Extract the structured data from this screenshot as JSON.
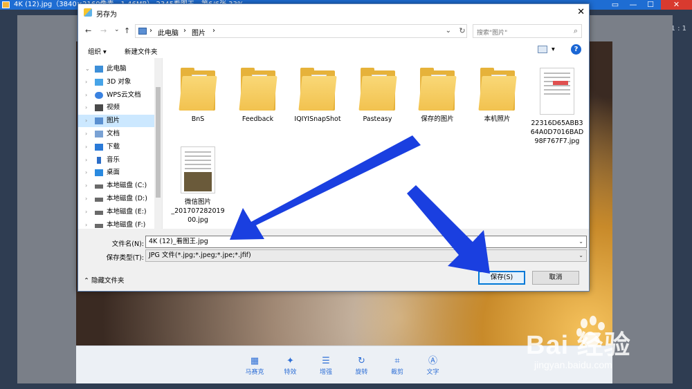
{
  "viewer": {
    "title": "4K (12).jpg（3840×2160像素，1.46MB）  2345看图王 - 第6/6张 33%",
    "zoom_label": "1 : 1",
    "window_controls": [
      "▭",
      "—",
      "☐",
      "✕"
    ],
    "toolbar": [
      {
        "label": "马赛克",
        "icon": "mosaic-icon",
        "glyph": "▦"
      },
      {
        "label": "特效",
        "icon": "magic-wand-icon",
        "glyph": "✦"
      },
      {
        "label": "增强",
        "icon": "sliders-icon",
        "glyph": "☰"
      },
      {
        "label": "旋转",
        "icon": "rotate-icon",
        "glyph": "↻"
      },
      {
        "label": "裁剪",
        "icon": "crop-icon",
        "glyph": "⌗"
      },
      {
        "label": "文字",
        "icon": "text-icon",
        "glyph": "Ⓐ"
      }
    ]
  },
  "dialog": {
    "title": "另存为",
    "close_glyph": "✕",
    "nav": {
      "back": "←",
      "forward": "→",
      "recent": "⌄",
      "up": "↑"
    },
    "breadcrumb": [
      "此电脑",
      "图片"
    ],
    "crumb_sep": "›",
    "dropdown_glyph": "⌄",
    "refresh_glyph": "↻",
    "search_placeholder": "搜索\"图片\"",
    "search_glyph": "⌕",
    "organize_label": "组织 ▾",
    "new_folder_label": "新建文件夹",
    "view_caret": "▾",
    "help_glyph": "?",
    "tree": [
      {
        "label": "此电脑",
        "chev": "⌄",
        "icon": "computer-icon",
        "color": "#3d8fd8",
        "selected": false
      },
      {
        "label": "3D 对象",
        "chev": "›",
        "icon": "cube-icon",
        "color": "#47a4e8",
        "selected": false
      },
      {
        "label": "WPS云文档",
        "chev": "›",
        "icon": "cloud-icon",
        "color": "#3a82e0",
        "selected": false
      },
      {
        "label": "视频",
        "chev": "›",
        "icon": "film-icon",
        "color": "#4a4a4a",
        "selected": false
      },
      {
        "label": "图片",
        "chev": "›",
        "icon": "picture-icon",
        "color": "#5a8fd0",
        "selected": true
      },
      {
        "label": "文档",
        "chev": "›",
        "icon": "document-icon",
        "color": "#7aa2d4",
        "selected": false
      },
      {
        "label": "下载",
        "chev": "›",
        "icon": "download-icon",
        "color": "#2a7ad8",
        "selected": false
      },
      {
        "label": "音乐",
        "chev": "›",
        "icon": "music-icon",
        "color": "#2c6ec8",
        "selected": false
      },
      {
        "label": "桌面",
        "chev": "›",
        "icon": "desktop-icon",
        "color": "#2a8ae0",
        "selected": false
      },
      {
        "label": "本地磁盘 (C:)",
        "chev": "›",
        "icon": "drive-icon",
        "color": "#6a6a6a",
        "selected": false
      },
      {
        "label": "本地磁盘 (D:)",
        "chev": "›",
        "icon": "drive-icon",
        "color": "#6a6a6a",
        "selected": false
      },
      {
        "label": "本地磁盘 (E:)",
        "chev": "›",
        "icon": "drive-icon",
        "color": "#6a6a6a",
        "selected": false
      },
      {
        "label": "本地磁盘 (F:)",
        "chev": "›",
        "icon": "drive-icon",
        "color": "#6a6a6a",
        "selected": false
      }
    ],
    "files": [
      {
        "name": "BnS",
        "kind": "folder"
      },
      {
        "name": "Feedback",
        "kind": "folder"
      },
      {
        "name": "IQIYISnapShot",
        "kind": "folder"
      },
      {
        "name": "Pasteasy",
        "kind": "folder"
      },
      {
        "name": "保存的图片",
        "kind": "folder"
      },
      {
        "name": "本机照片",
        "kind": "folder"
      },
      {
        "name": "22316D65ABB364A0D7016BAD98F767F7.jpg",
        "name_lines": [
          "22316D65ABB3",
          "64A0D7016BAD",
          "98F767F7.jpg"
        ],
        "kind": "image"
      },
      {
        "name": "微信图片_20170728201900.jpg",
        "name_lines": [
          "微信图片",
          "_201707282019",
          "00.jpg"
        ],
        "kind": "image"
      }
    ],
    "filename_label": "文件名(N):",
    "filename_value": "4K (12)_看图王.jpg",
    "filetype_label": "保存类型(T):",
    "filetype_value": "JPG 文件(*.jpg;*.jpeg;*.jpe;*.jfif)",
    "hide_folders_label": "隐藏文件夹",
    "hide_caret": "⌃",
    "save_label": "保存(S)",
    "cancel_label": "取消"
  },
  "watermark": {
    "brand": "Bai  经验",
    "url": "jingyan.baidu.com"
  },
  "colors": {
    "titlebar": "#1e6dd3",
    "arrow": "#1a3fe0",
    "accent": "#0078d7",
    "folder": "#f2c24f"
  }
}
